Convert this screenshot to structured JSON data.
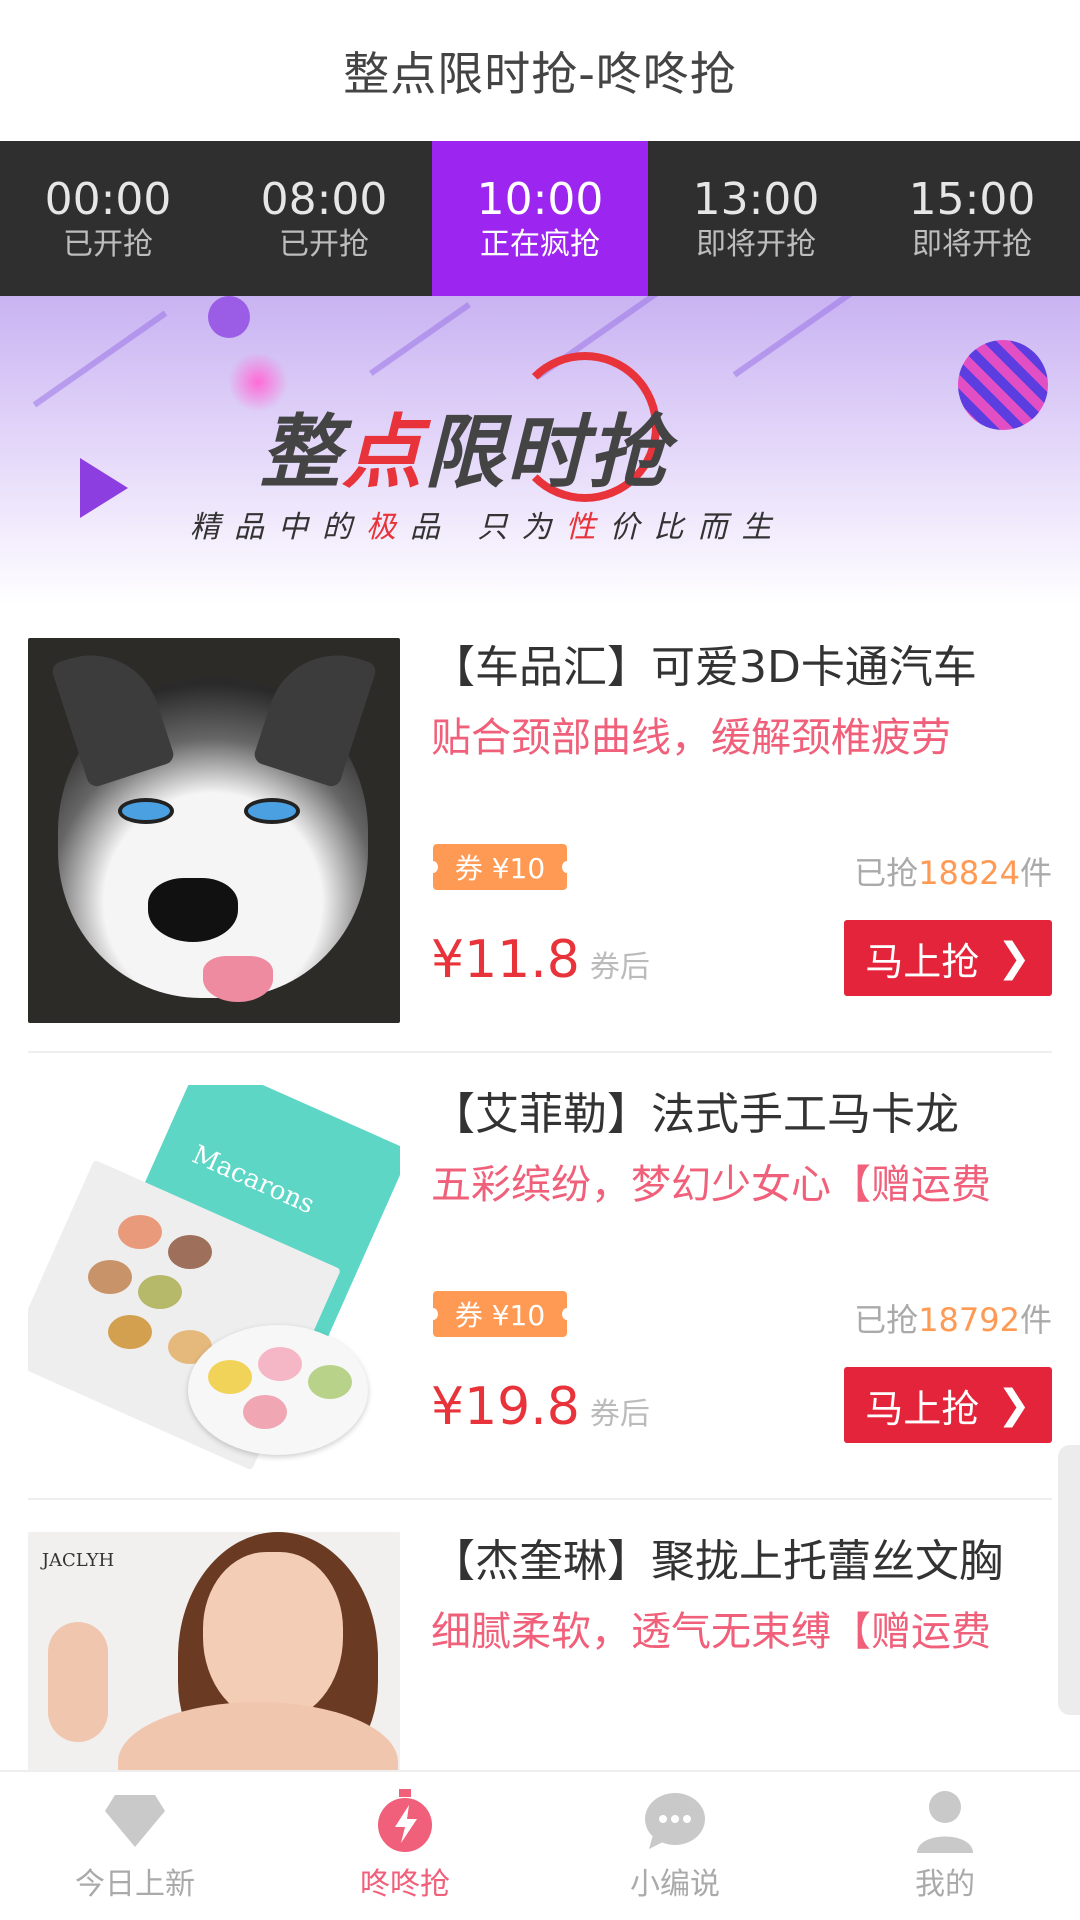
{
  "header": {
    "title": "整点限时抢-咚咚抢"
  },
  "time_slots": [
    {
      "time": "00:00",
      "status": "已开抢",
      "active": false
    },
    {
      "time": "08:00",
      "status": "已开抢",
      "active": false
    },
    {
      "time": "10:00",
      "status": "正在疯抢",
      "active": true
    },
    {
      "time": "13:00",
      "status": "即将开抢",
      "active": false
    },
    {
      "time": "15:00",
      "status": "即将开抢",
      "active": false
    }
  ],
  "banner": {
    "logo_left": "整",
    "logo_red": "点",
    "logo_right": "限时抢",
    "slogan_a": "精品中的",
    "slogan_b": "极",
    "slogan_c": "品 只为",
    "slogan_d": "性",
    "slogan_e": "价比而生"
  },
  "products": [
    {
      "name": "【车品汇】可爱3D卡通汽车",
      "desc": "贴合颈部曲线，缓解颈椎疲劳",
      "coupon": "券 ¥10",
      "sold_prefix": "已抢",
      "sold_count": "18824",
      "sold_suffix": "件",
      "price": "¥11.8",
      "price_note": "券后",
      "buy_label": "马上抢"
    },
    {
      "name": "【艾菲勒】法式手工马卡龙",
      "desc": "五彩缤纷，梦幻少女心【赠运费",
      "coupon": "券 ¥10",
      "sold_prefix": "已抢",
      "sold_count": "18792",
      "sold_suffix": "件",
      "price": "¥19.8",
      "price_note": "券后",
      "buy_label": "马上抢",
      "image_text": "Macarons"
    },
    {
      "name": "【杰奎琳】聚拢上托蕾丝文胸",
      "desc": "细腻柔软，透气无束缚【赠运费",
      "image_text": "JACLYH"
    }
  ],
  "tabbar": [
    {
      "label": "今日上新",
      "icon": "diamond-icon",
      "active": false
    },
    {
      "label": "咚咚抢",
      "icon": "stopwatch-icon",
      "active": true
    },
    {
      "label": "小编说",
      "icon": "chat-bubble-icon",
      "active": false
    },
    {
      "label": "我的",
      "icon": "person-icon",
      "active": false
    }
  ],
  "colors": {
    "accent_purple": "#9c26f0",
    "price_red": "#e8333a",
    "coupon_orange": "#ff9a54",
    "desc_pink": "#f0607a"
  }
}
